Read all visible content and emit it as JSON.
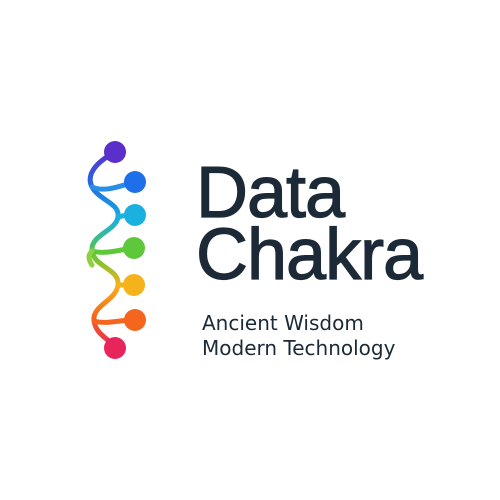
{
  "brand": {
    "line1": "Data",
    "line2": "Chakra"
  },
  "tagline": {
    "line1": "Ancient Wisdom",
    "line2": "Modern Technology"
  },
  "colors": {
    "text": "#1c2a38",
    "background": "#ffffff",
    "nodes": [
      "#5b2fc9",
      "#1f6fe8",
      "#1ab0e0",
      "#5cc83a",
      "#f4b21b",
      "#f4661e",
      "#e8255a"
    ]
  },
  "icons": {
    "logo": "chakra-chain-icon"
  }
}
